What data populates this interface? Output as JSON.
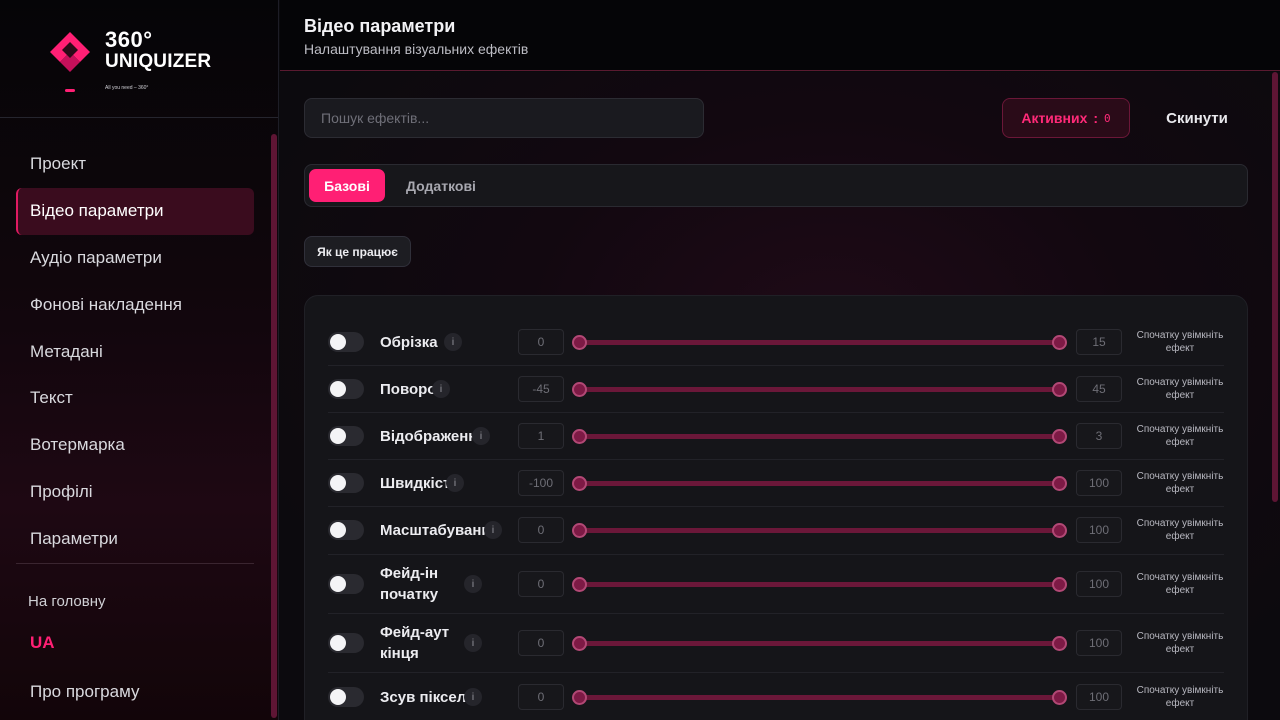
{
  "brand": {
    "line1": "360°",
    "line2": "UNIQUIZER",
    "tagline": "All you need – 360°",
    "accent": "#ff1f74"
  },
  "sidebar": {
    "items": [
      {
        "label": "Проект",
        "active": false
      },
      {
        "label": "Відео параметри",
        "active": true
      },
      {
        "label": "Аудіо параметри",
        "active": false
      },
      {
        "label": "Фонові накладення",
        "active": false
      },
      {
        "label": "Метадані",
        "active": false
      },
      {
        "label": "Текст",
        "active": false
      },
      {
        "label": "Вотермарка",
        "active": false
      },
      {
        "label": "Профілі",
        "active": false
      },
      {
        "label": "Параметри",
        "active": false
      }
    ],
    "home": "На головну",
    "language": "UA",
    "about": "Про програму"
  },
  "header": {
    "title": "Відео параметри",
    "subtitle": "Налаштування візуальних ефектів"
  },
  "toolbar": {
    "search_placeholder": "Пошук ефектів...",
    "active_label": "Активних",
    "active_sep": ":",
    "active_count": "0",
    "reset_label": "Скинути"
  },
  "tabs": [
    "Базові",
    "Додаткові"
  ],
  "how_it_works": "Як це працює",
  "effects": [
    {
      "name": "Обрізка",
      "min": "0",
      "max": "15",
      "enabled": false,
      "hint": "Спочатку увімкніть ефект"
    },
    {
      "name": "Поворот",
      "min": "-45",
      "max": "45",
      "enabled": false,
      "hint": "Спочатку увімкніть ефект"
    },
    {
      "name": "Відображення",
      "min": "1",
      "max": "3",
      "enabled": false,
      "hint": "Спочатку увімкніть ефект"
    },
    {
      "name": "Швидкість",
      "min": "-100",
      "max": "100",
      "enabled": false,
      "hint": "Спочатку увімкніть ефект"
    },
    {
      "name": "Масштабування",
      "min": "0",
      "max": "100",
      "enabled": false,
      "hint": "Спочатку увімкніть ефект"
    },
    {
      "name": "Фейд-ін початку",
      "min": "0",
      "max": "100",
      "enabled": false,
      "hint": "Спочатку увімкніть ефект"
    },
    {
      "name": "Фейд-аут кінця",
      "min": "0",
      "max": "100",
      "enabled": false,
      "hint": "Спочатку увімкніть ефект"
    },
    {
      "name": "Зсув пікселів",
      "min": "0",
      "max": "100",
      "enabled": false,
      "hint": "Спочатку увімкніть ефект"
    }
  ],
  "info_glyph": "i"
}
